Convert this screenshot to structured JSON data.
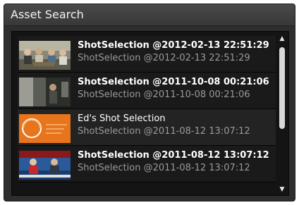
{
  "panel": {
    "title": "Asset Search"
  },
  "items": [
    {
      "title": "ShotSelection @2012-02-13 22:51:29",
      "subtitle": "ShotSelection @2012-02-13 22:51:29",
      "thumbnail": "people-seated-room"
    },
    {
      "title": "ShotSelection @2011-10-08 00:21:06",
      "subtitle": "ShotSelection @2011-10-08 00:21:06",
      "thumbnail": "interior-scene"
    },
    {
      "title": "Ed's Shot Selection",
      "subtitle": "ShotSelection @2011-08-12 13:07:12",
      "thumbnail": "tvt-logo-orange"
    },
    {
      "title": "ShotSelection @2011-08-12 13:07:12",
      "subtitle": "ShotSelection @2011-08-12 13:07:12",
      "thumbnail": "news-studio-anchors"
    }
  ],
  "scrollbar": {
    "up_icon": "triangle-up-icon",
    "down_icon": "triangle-down-icon",
    "up_glyph": "▲",
    "down_glyph": "▼"
  },
  "colors": {
    "panel_bg": "#2e2e2e",
    "list_bg": "#141414",
    "title_text": "#ffffff",
    "subtitle_text": "#9a9a9a",
    "logo_orange": "#e8741c"
  }
}
